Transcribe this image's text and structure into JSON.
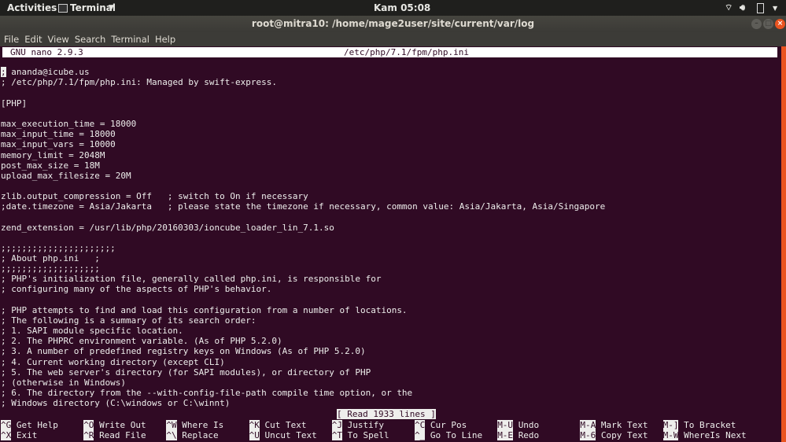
{
  "topbar": {
    "activities": "Activities",
    "app": "Terminal",
    "clock": "Kam 05:08",
    "icons": [
      "wifi-icon",
      "volume-icon",
      "battery-icon",
      "chevron-down-icon"
    ]
  },
  "window": {
    "title": "root@mitra10: /home/mage2user/site/current/var/log"
  },
  "menu": [
    "File",
    "Edit",
    "View",
    "Search",
    "Terminal",
    "Help"
  ],
  "nano": {
    "version": "GNU nano 2.9.3",
    "file": "/etc/php/7.1/fpm/php.ini",
    "status": "[ Read 1933 lines ]",
    "cursor_char": ";",
    "lines": [
      " ananda@icube.us",
      "; /etc/php/7.1/fpm/php.ini: Managed by swift-express.",
      "",
      "[PHP]",
      "",
      "max_execution_time = 18000",
      "max_input_time = 18000",
      "max_input_vars = 10000",
      "memory_limit = 2048M",
      "post_max_size = 18M",
      "upload_max_filesize = 20M",
      "",
      "zlib.output_compression = Off   ; switch to On if necessary",
      ";date.timezone = Asia/Jakarta   ; please state the timezone if necessary, common value: Asia/Jakarta, Asia/Singapore",
      "",
      "zend_extension = /usr/lib/php/20160303/ioncube_loader_lin_7.1.so",
      "",
      ";;;;;;;;;;;;;;;;;;;;;;",
      "; About php.ini   ;",
      ";;;;;;;;;;;;;;;;;;;",
      "; PHP's initialization file, generally called php.ini, is responsible for",
      "; configuring many of the aspects of PHP's behavior.",
      "",
      "; PHP attempts to find and load this configuration from a number of locations.",
      "; The following is a summary of its search order:",
      "; 1. SAPI module specific location.",
      "; 2. The PHPRC environment variable. (As of PHP 5.2.0)",
      "; 3. A number of predefined registry keys on Windows (As of PHP 5.2.0)",
      "; 4. Current working directory (except CLI)",
      "; 5. The web server's directory (for SAPI modules), or directory of PHP",
      "; (otherwise in Windows)",
      "; 6. The directory from the --with-config-file-path compile time option, or the",
      "; Windows directory (C:\\windows or C:\\winnt)"
    ],
    "shortcuts": [
      [
        {
          "key": "^G",
          "label": "Get Help"
        },
        {
          "key": "^O",
          "label": "Write Out"
        },
        {
          "key": "^W",
          "label": "Where Is"
        },
        {
          "key": "^K",
          "label": "Cut Text"
        },
        {
          "key": "^J",
          "label": "Justify"
        },
        {
          "key": "^C",
          "label": "Cur Pos"
        },
        {
          "key": "M-U",
          "label": "Undo"
        },
        {
          "key": "M-A",
          "label": "Mark Text"
        },
        {
          "key": "M-]",
          "label": "To Bracket"
        }
      ],
      [
        {
          "key": "^X",
          "label": "Exit"
        },
        {
          "key": "^R",
          "label": "Read File"
        },
        {
          "key": "^\\",
          "label": "Replace"
        },
        {
          "key": "^U",
          "label": "Uncut Text"
        },
        {
          "key": "^T",
          "label": "To Spell"
        },
        {
          "key": "^_",
          "label": "Go To Line"
        },
        {
          "key": "M-E",
          "label": "Redo"
        },
        {
          "key": "M-6",
          "label": "Copy Text"
        },
        {
          "key": "M-W",
          "label": "WhereIs Next"
        }
      ]
    ]
  },
  "colors": {
    "terminal_bg": "#300a24",
    "accent": "#e95420"
  }
}
